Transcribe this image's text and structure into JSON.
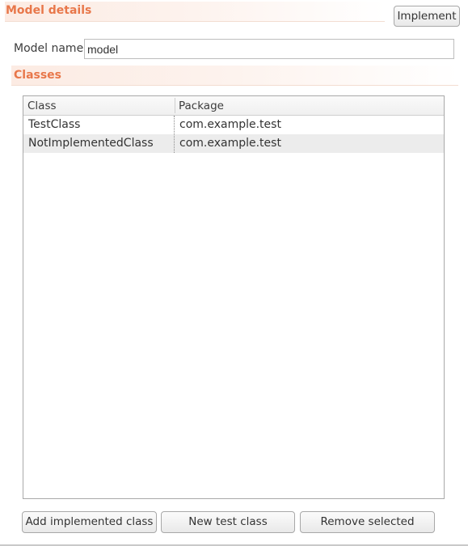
{
  "model_details": {
    "title": "Model details",
    "implement_label": "Implement",
    "model_name_label": "Model name",
    "model_name_value": "model"
  },
  "classes": {
    "title": "Classes",
    "columns": [
      "Class",
      "Package"
    ],
    "rows": [
      {
        "class": "TestClass",
        "package": "com.example.test"
      },
      {
        "class": "NotImplementedClass",
        "package": "com.example.test"
      }
    ]
  },
  "actions": {
    "add_implemented": "Add implemented class",
    "new_test": "New test class",
    "remove_selected": "Remove selected"
  }
}
